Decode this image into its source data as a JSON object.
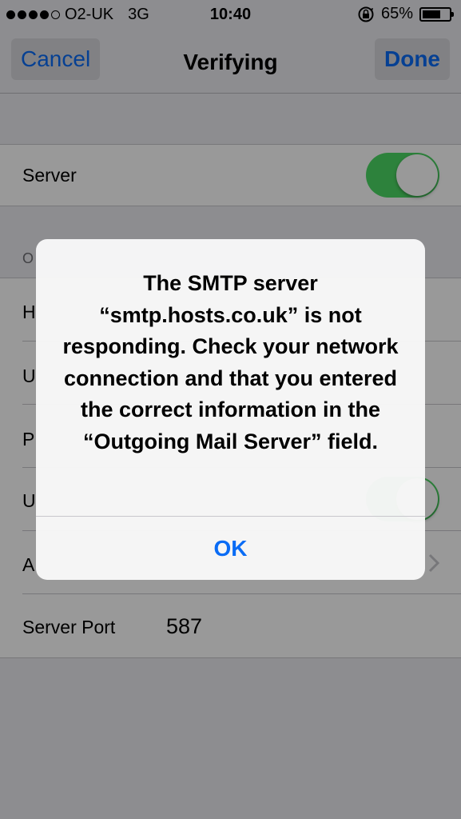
{
  "status_bar": {
    "carrier": "O2-UK",
    "network": "3G",
    "time": "10:40",
    "battery_percent": "65%",
    "battery_level": 0.65,
    "signal_bars_filled": 4,
    "signal_bars_total": 5
  },
  "nav": {
    "cancel_label": "Cancel",
    "title": "Verifying",
    "done_label": "Done"
  },
  "settings": {
    "server_label": "Server",
    "server_enabled": true,
    "section_header_partial": "O",
    "row_host_partial": "H",
    "row_username_partial": "U",
    "row_password_partial": "P",
    "row_ssl_partial": "U",
    "row_auth_partial": "A",
    "server_port_label": "Server Port",
    "server_port_value": "587"
  },
  "alert": {
    "message": "The SMTP server “smtp.hosts.co.uk” is not responding. Check your network connection and that you entered the correct information in the “Outgoing Mail Server” field.",
    "ok_label": "OK"
  },
  "colors": {
    "ios_blue": "#0a6cf5",
    "toggle_green": "#4cd964"
  }
}
